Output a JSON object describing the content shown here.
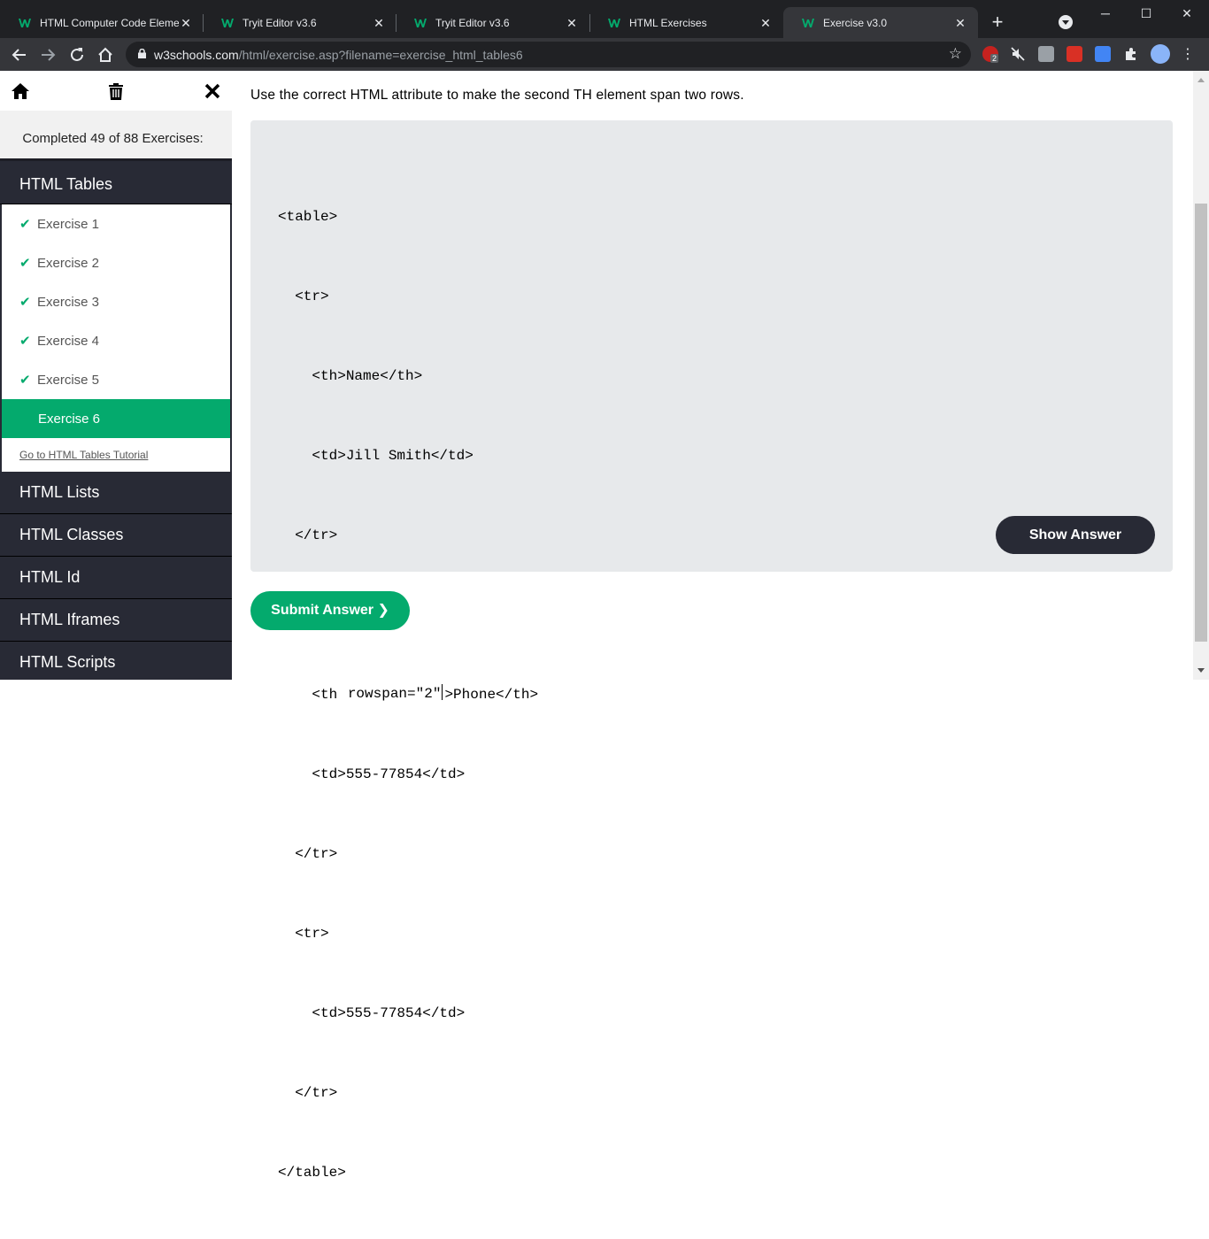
{
  "browser": {
    "tabs": [
      {
        "title": "HTML Computer Code Eleme",
        "active": false
      },
      {
        "title": "Tryit Editor v3.6",
        "active": false
      },
      {
        "title": "Tryit Editor v3.6",
        "active": false
      },
      {
        "title": "HTML Exercises",
        "active": false
      },
      {
        "title": "Exercise v3.0",
        "active": true
      }
    ],
    "new_tab": "+",
    "url_host": "w3schools.com",
    "url_path": "/html/exercise.asp?filename=exercise_html_tables6",
    "extension_badge": "2",
    "colors": {
      "brand_green": "#04aa6d",
      "dark": "#282a35",
      "chrome_dark": "#202124",
      "chrome_toolbar": "#35363a"
    }
  },
  "sidebar": {
    "completed": "Completed 49 of 88 Exercises:",
    "current_category": "HTML Tables",
    "exercises": [
      {
        "label": "Exercise 1",
        "done": true
      },
      {
        "label": "Exercise 2",
        "done": true
      },
      {
        "label": "Exercise 3",
        "done": true
      },
      {
        "label": "Exercise 4",
        "done": true
      },
      {
        "label": "Exercise 5",
        "done": true
      },
      {
        "label": "Exercise 6",
        "done": false,
        "active": true
      }
    ],
    "tutorial_link": "Go to HTML Tables Tutorial",
    "categories": [
      "HTML Lists",
      "HTML Classes",
      "HTML Id",
      "HTML Iframes",
      "HTML Scripts"
    ]
  },
  "exercise": {
    "question": "Use the correct HTML attribute to make the second TH element span two rows.",
    "code_lines": [
      "<table>",
      "  <tr>",
      "    <th>Name</th>",
      "    <td>Jill Smith</td>",
      "  </tr>",
      "  <tr>",
      "    <th ",
      "    <td>555-77854</td>",
      "  </tr>",
      "  <tr>",
      "    <td>555-77854</td>",
      "  </tr>",
      "</table>"
    ],
    "answer_value": "rowspan=\"2\"",
    "answer_suffix": ">Phone</th>",
    "show_answer": "Show Answer",
    "submit": "Submit Answer ❯"
  }
}
